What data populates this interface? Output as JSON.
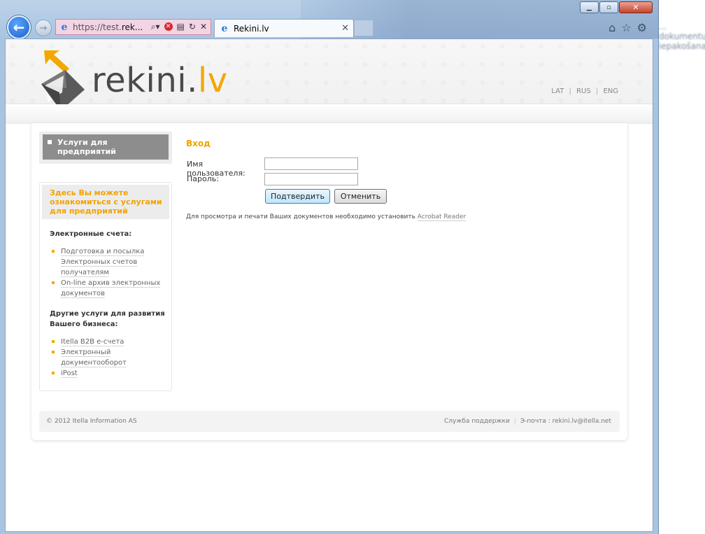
{
  "browser": {
    "address_prefix": "https://test.",
    "address_host": "rek...",
    "tab_title": "Rekini.lv",
    "background_tab_title": "... dokumentu iepakošana",
    "new_tab_symbol": "",
    "window_buttons": {
      "minimize": "▁",
      "maximize": "▫",
      "close": "✕"
    }
  },
  "header": {
    "logo_main": "rekini.",
    "logo_accent": "lv",
    "languages": [
      "LAT",
      "RUS",
      "ENG"
    ],
    "separator": "|"
  },
  "sidebar": {
    "active_item": "Услуги для предприятий",
    "info_title": "Здесь Вы можете ознакомиться с услугами для предприятий",
    "section1_title": "Электронные счета:",
    "section1_items": [
      "Подготовка и посылка Электронных счетов получателям",
      "On-line архив электронных документов"
    ],
    "section2_title": "Другие услуги для развития Вашего бизнеса:",
    "section2_items": [
      "Itella B2B e-счета",
      "Электронный документооборот",
      "iPost"
    ]
  },
  "login": {
    "title": "Вход",
    "username_label": "Имя пользователя:",
    "password_label": "Пароль:",
    "username_value": "",
    "password_value": "",
    "submit_label": "Подтвердить",
    "cancel_label": "Отменить",
    "note_text": "Для просмотра и печати Ваших документов необходимо установить",
    "note_link": "Acrobat Reader"
  },
  "footer": {
    "copyright": "© 2012 Itella Information AS",
    "support": "Служба поддержки",
    "email": "Э-почта : rekini.lv@itella.net",
    "separator": "|"
  },
  "colors": {
    "accent": "#f2a800",
    "logo_gray": "#4a4a4a",
    "active_menu": "#8d8d8d"
  },
  "icons": [
    "back-arrow-icon",
    "forward-arrow-icon",
    "ie-logo-icon",
    "search-icon",
    "stop-icon",
    "compat-view-icon",
    "refresh-icon",
    "close-icon",
    "home-icon",
    "favorites-star-icon",
    "tools-gear-icon",
    "envelope-logo-icon"
  ]
}
